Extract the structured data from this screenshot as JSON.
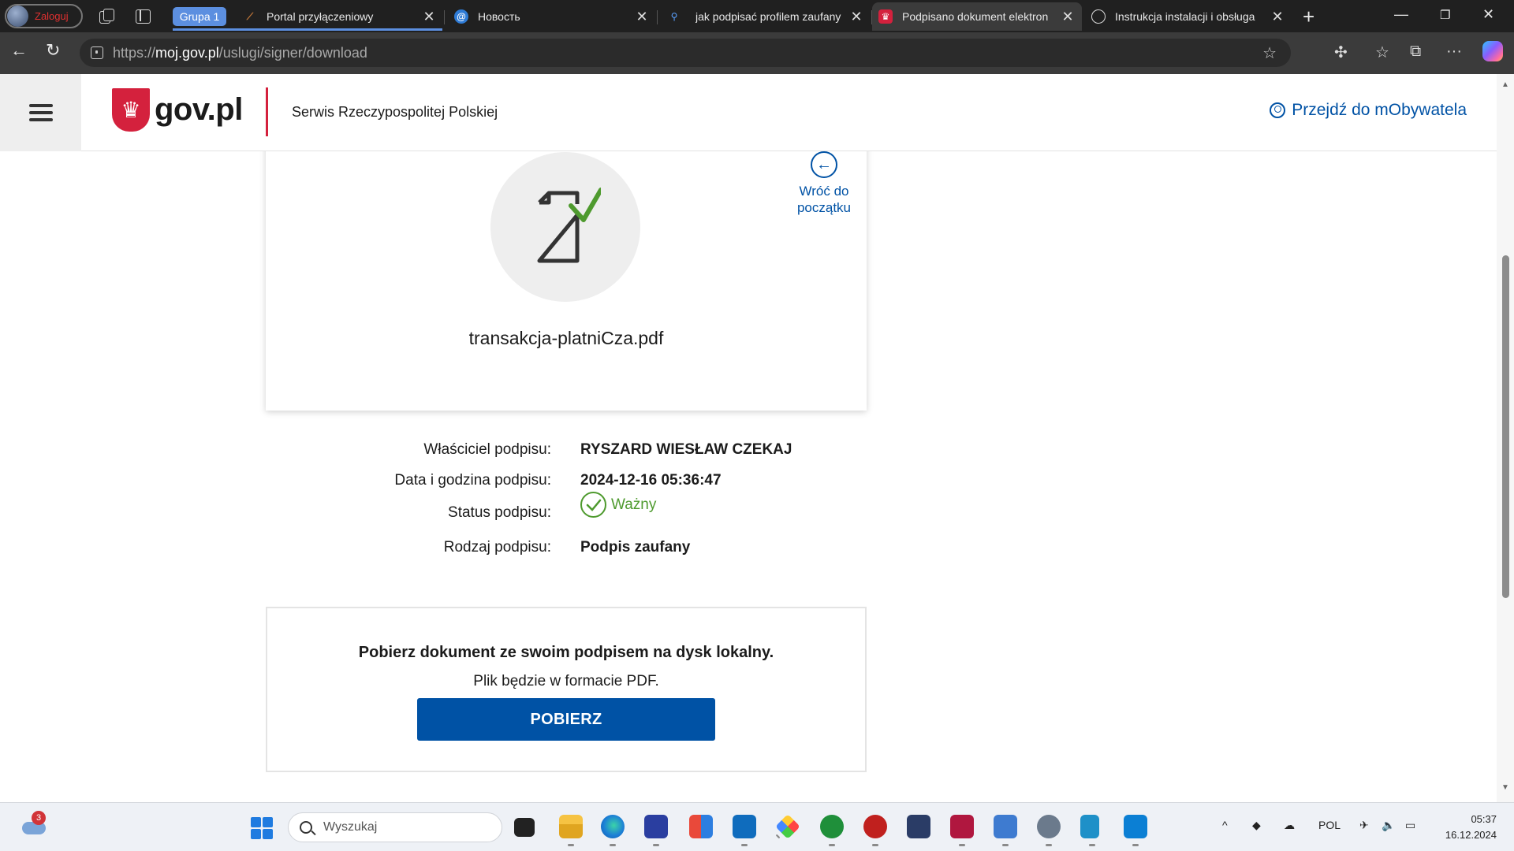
{
  "browser": {
    "profile_label": "Zaloguj",
    "group_label": "Grupa 1",
    "tabs": [
      {
        "title": "Portal przyłączeniowy",
        "icon": "portal-favicon-icon",
        "active": false
      },
      {
        "title": "Новость",
        "icon": "at-sign-icon",
        "active": false
      },
      {
        "title": "jak podpisać profilem zaufany",
        "icon": "search-icon",
        "active": false
      },
      {
        "title": "Podpisano dokument elektron",
        "icon": "gov-eagle-icon",
        "active": true
      },
      {
        "title": "Instrukcja instalacji i obsługa",
        "icon": "globe-icon",
        "active": false
      }
    ],
    "address": {
      "prefix": "https://",
      "host": "moj.gov.pl",
      "path": "/uslugi/signer/download"
    }
  },
  "site": {
    "logo_text": "gov.pl",
    "service_name": "Serwis Rzeczypospolitej Polskiej",
    "mobywatel_link": "Przejdź do mObywatela"
  },
  "document": {
    "back_label_line1": "Wróć do",
    "back_label_line2": "początku",
    "filename": "transakcja-platniCza.pdf"
  },
  "signature": {
    "owner_label": "Właściciel podpisu:",
    "owner_value": "RYSZARD WIESŁAW CZEKAJ",
    "date_label": "Data i godzina podpisu:",
    "date_value": "2024-12-16 05:36:47",
    "status_label": "Status podpisu:",
    "status_value": "Ważny",
    "type_label": "Rodzaj podpisu:",
    "type_value": "Podpis zaufany"
  },
  "download": {
    "title": "Pobierz dokument ze swoim podpisem na dysk lokalny.",
    "subtitle": "Plik będzie w formacie PDF.",
    "button": "POBIERZ"
  },
  "taskbar": {
    "notification_count": "3",
    "search_placeholder": "Wyszukaj",
    "language": "POL",
    "time": "05:37",
    "date": "16.12.2024"
  },
  "colors": {
    "gov_blue": "#0052a5",
    "gov_red": "#d4213d",
    "valid_green": "#4e9a2e",
    "tab_group": "#5c8fe0"
  }
}
